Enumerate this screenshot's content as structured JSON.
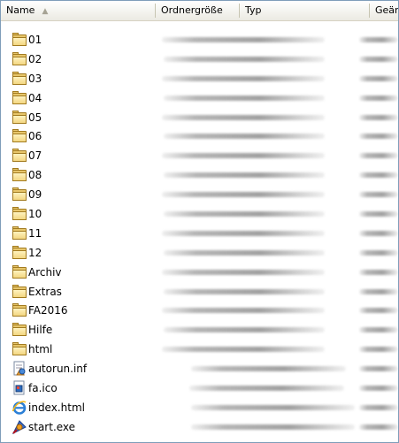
{
  "columns": {
    "name": "Name",
    "size": "Ordnergröße",
    "type": "Typ",
    "modified": "Geändert"
  },
  "items": [
    {
      "label": "01",
      "icon": "folder-icon"
    },
    {
      "label": "02",
      "icon": "folder-icon"
    },
    {
      "label": "03",
      "icon": "folder-icon"
    },
    {
      "label": "04",
      "icon": "folder-icon"
    },
    {
      "label": "05",
      "icon": "folder-icon"
    },
    {
      "label": "06",
      "icon": "folder-icon"
    },
    {
      "label": "07",
      "icon": "folder-icon"
    },
    {
      "label": "08",
      "icon": "folder-icon"
    },
    {
      "label": "09",
      "icon": "folder-icon"
    },
    {
      "label": "10",
      "icon": "folder-icon"
    },
    {
      "label": "11",
      "icon": "folder-icon"
    },
    {
      "label": "12",
      "icon": "folder-icon"
    },
    {
      "label": "Archiv",
      "icon": "folder-icon"
    },
    {
      "label": "Extras",
      "icon": "folder-icon"
    },
    {
      "label": "FA2016",
      "icon": "folder-icon"
    },
    {
      "label": "Hilfe",
      "icon": "folder-icon"
    },
    {
      "label": "html",
      "icon": "folder-icon"
    },
    {
      "label": "autorun.inf",
      "icon": "setup-info-file-icon"
    },
    {
      "label": "fa.ico",
      "icon": "icon-file-icon"
    },
    {
      "label": "index.html",
      "icon": "internet-explorer-icon"
    },
    {
      "label": "start.exe",
      "icon": "application-exe-icon"
    }
  ]
}
